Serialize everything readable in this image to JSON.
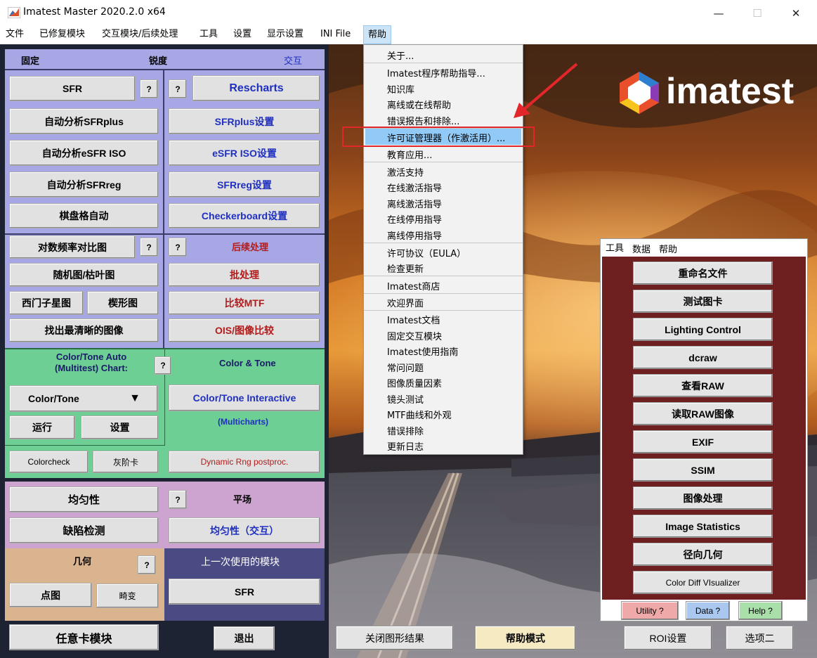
{
  "window": {
    "title": "Imatest Master 2020.2.0 x64",
    "minimize": "—",
    "maximize": "☐",
    "close": "✕"
  },
  "menubar": [
    "文件",
    "已修复模块",
    "交互模块/后续处理",
    "工具",
    "设置",
    "显示设置",
    "INI File",
    "帮助"
  ],
  "sharpness": {
    "header_fixed": "固定",
    "header_title": "锐度",
    "header_interactive": "交互",
    "sfr": "SFR",
    "rescharts": "Rescharts",
    "auto_sfrplus": "自动分析SFRplus",
    "sfrplus_settings": "SFRplus设置",
    "auto_esfr": "自动分析eSFR ISO",
    "esfr_settings": "eSFR ISO设置",
    "auto_sfrreg": "自动分析SFRreg",
    "sfrreg_settings": "SFRreg设置",
    "checker_auto": "棋盘格自动",
    "checker_settings": "Checkerboard设置"
  },
  "misc": {
    "log_freq": "对数频率对比图",
    "post_process": "后续处理",
    "random": "随机图/枯叶图",
    "batch": "批处理",
    "siemens": "西门子星图",
    "wedge": "楔形图",
    "compare_mtf": "比较MTF",
    "sharpest": "找出最清晰的图像",
    "ois": "OIS/图像比较"
  },
  "color": {
    "auto_title": "Color/Tone Auto\n(Multitest)   Chart:",
    "interactive_title": "Color & Tone",
    "dropdown": "Color/Tone",
    "interactive_btn": "Color/Tone Interactive",
    "multicharts": "(Multicharts)",
    "run": "运行",
    "settings": "设置",
    "colorcheck": "Colorcheck",
    "grayscale": "灰阶卡",
    "dynamic": "Dynamic Rng postproc."
  },
  "uniformity": {
    "uniformity": "均匀性",
    "flat": "平场",
    "defect": "缺陷检测",
    "uniformity_int": "均匀性（交互）"
  },
  "geometry": {
    "title": "几何",
    "dot": "点图",
    "distortion": "畸变",
    "last_title": "上一次使用的模块",
    "last_btn": "SFR"
  },
  "bottom": {
    "any_chart": "任意卡模块",
    "exit": "退出",
    "close_figs": "关闭图形结果",
    "help_mode": "帮助模式",
    "roi": "ROI设置",
    "option2": "选项二"
  },
  "question": "?",
  "logo": "imatest",
  "help_menu": [
    "关于...",
    "Imatest程序帮助指导...",
    "知识库",
    "离线或在线帮助",
    "错误报告和排除...",
    "许可证管理器（作激活用）...",
    "教育应用...",
    "激活支持",
    "在线激活指导",
    "离线激活指导",
    "在线停用指导",
    "离线停用指导",
    "许可协议（EULA）",
    "检查更新",
    "Imatest商店",
    "欢迎界面",
    "Imatest文档",
    "固定交互模块",
    "Imatest使用指南",
    "常问问题",
    "图像质量因素",
    "镜头测试",
    "MTF曲线和外观",
    "错误排除",
    "更新日志"
  ],
  "tools": {
    "tabs": [
      "工具",
      "数据",
      "帮助"
    ],
    "buttons": [
      "重命名文件",
      "测试图卡",
      "Lighting Control",
      "dcraw",
      "查看RAW",
      "读取RAW图像",
      "EXIF",
      "SSIM",
      "图像处理",
      "Image Statistics",
      "径向几何",
      "Color Diff VIsualizer"
    ],
    "utility": "Utility ?",
    "data": "Data ?",
    "help": "Help ?"
  }
}
